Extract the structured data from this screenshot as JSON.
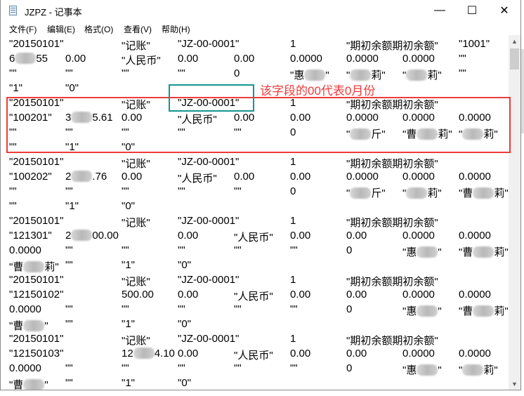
{
  "window": {
    "title": "JZPZ - 记事本",
    "minimize": "—",
    "maximize": "☐",
    "close": "✕"
  },
  "menu": [
    "文件(F)",
    "编辑(E)",
    "格式(O)",
    "查看(V)",
    "帮助(H)"
  ],
  "annotation": {
    "text": "该字段的00代表0月份",
    "color": "#ef3b3b",
    "box_color": "#14968e"
  },
  "lines": [
    [
      [
        0,
        "\"20150101\""
      ],
      [
        2,
        "\"记账\""
      ],
      [
        3,
        "\"JZ-00-0001\""
      ],
      [
        5,
        "1"
      ],
      [
        6,
        "\"期初余额期初余额\""
      ],
      [
        8,
        "\"1001\""
      ]
    ],
    [
      [
        0,
        {
          "pre": "6",
          "post": "55"
        }
      ],
      [
        1,
        "0.00"
      ],
      [
        2,
        "\"人民币\""
      ],
      [
        3,
        "0.00"
      ],
      [
        4,
        "0.00"
      ],
      [
        5,
        "0.0000"
      ],
      [
        6,
        "0.0000"
      ],
      [
        7,
        "0.0000"
      ],
      [
        8,
        "\"\""
      ]
    ],
    [
      [
        0,
        "\"\""
      ],
      [
        1,
        "\"\""
      ],
      [
        2,
        "\"\""
      ],
      [
        3,
        "\"\""
      ],
      [
        4,
        "0"
      ],
      [
        5,
        {
          "pre": "\"惠",
          "post": "\""
        }
      ],
      [
        6,
        {
          "pre": "\"",
          "post": "莉\""
        }
      ],
      [
        7,
        {
          "pre": "\"",
          "post": "莉\""
        }
      ],
      [
        8,
        "\"\""
      ]
    ],
    [
      [
        0,
        "\"1\""
      ],
      [
        1,
        "\"0\""
      ]
    ],
    [
      [
        0,
        "\"20150101\""
      ],
      [
        2,
        "\"记账\""
      ],
      [
        3,
        "\"JZ-00-0001\""
      ],
      [
        5,
        "1"
      ],
      [
        6,
        "\"期初余额期初余额\""
      ]
    ],
    [
      [
        0,
        "\"100201\""
      ],
      [
        1,
        {
          "pre": "3",
          "post": "5.61"
        }
      ],
      [
        2,
        "0.00"
      ],
      [
        3,
        "\"人民币\""
      ],
      [
        4,
        "0.00"
      ],
      [
        5,
        "0.00"
      ],
      [
        6,
        "0.0000"
      ],
      [
        7,
        "0.0000"
      ],
      [
        8,
        "0.0000"
      ]
    ],
    [
      [
        0,
        "\"\""
      ],
      [
        1,
        "\"\""
      ],
      [
        2,
        "\"\""
      ],
      [
        3,
        "\"\""
      ],
      [
        4,
        "\"\""
      ],
      [
        5,
        "0"
      ],
      [
        6,
        {
          "pre": "\"",
          "post": "斤\""
        }
      ],
      [
        7,
        {
          "pre": "\"曹",
          "post": "莉\""
        }
      ],
      [
        8,
        {
          "pre": "\"",
          "post": "莉\""
        }
      ]
    ],
    [
      [
        0,
        "\"\""
      ],
      [
        1,
        "\"1\""
      ],
      [
        2,
        "\"0\""
      ]
    ],
    [
      [
        0,
        "\"20150101\""
      ],
      [
        2,
        "\"记账\""
      ],
      [
        3,
        "\"JZ-00-0001\""
      ],
      [
        5,
        "1"
      ],
      [
        6,
        "\"期初余额期初余额\""
      ]
    ],
    [
      [
        0,
        "\"100202\""
      ],
      [
        1,
        {
          "pre": "2",
          "post": ".76"
        }
      ],
      [
        2,
        "0.00"
      ],
      [
        3,
        "\"人民币\""
      ],
      [
        4,
        "0.00"
      ],
      [
        5,
        "0.00"
      ],
      [
        6,
        "0.0000"
      ],
      [
        7,
        "0.0000"
      ],
      [
        8,
        "0.0000"
      ]
    ],
    [
      [
        0,
        "\"\""
      ],
      [
        1,
        "\"\""
      ],
      [
        2,
        "\"\""
      ],
      [
        3,
        "\"\""
      ],
      [
        4,
        "\"\""
      ],
      [
        5,
        "0"
      ],
      [
        6,
        {
          "pre": "\"",
          "post": "斤\""
        }
      ],
      [
        7,
        {
          "pre": "\"",
          "post": "莉\""
        }
      ],
      [
        8,
        {
          "pre": "\"曹",
          "post": "莉\""
        }
      ]
    ],
    [
      [
        0,
        "\"\""
      ],
      [
        1,
        "\"1\""
      ],
      [
        2,
        "\"0\""
      ]
    ],
    [
      [
        0,
        "\"20150101\""
      ],
      [
        2,
        "\"记账\""
      ],
      [
        3,
        "\"JZ-00-0001\""
      ],
      [
        5,
        "1"
      ],
      [
        6,
        "\"期初余额期初余额\""
      ]
    ],
    [
      [
        0,
        "\"121301\""
      ],
      [
        1,
        {
          "pre": "2",
          "post": "00.00"
        }
      ],
      [
        3,
        "0.00"
      ],
      [
        4,
        "\"人民币\""
      ],
      [
        5,
        "0.00"
      ],
      [
        6,
        "0.00"
      ],
      [
        7,
        "0.0000"
      ],
      [
        8,
        "0.0000"
      ]
    ],
    [
      [
        0,
        "0.0000"
      ],
      [
        1,
        "\"\""
      ],
      [
        2,
        "\"\""
      ],
      [
        3,
        "\"\""
      ],
      [
        4,
        "\"\""
      ],
      [
        5,
        "\"\""
      ],
      [
        6,
        "0"
      ],
      [
        7,
        {
          "pre": "\"惠",
          "post": "\""
        }
      ],
      [
        8,
        {
          "pre": "\"曹",
          "post": "莉\""
        }
      ]
    ],
    [
      [
        0,
        {
          "pre": "\"曹",
          "post": "莉\""
        }
      ],
      [
        1,
        "\"\""
      ],
      [
        2,
        "\"1\""
      ],
      [
        3,
        "\"0\""
      ]
    ],
    [
      [
        0,
        "\"20150101\""
      ],
      [
        2,
        "\"记账\""
      ],
      [
        3,
        "\"JZ-00-0001\""
      ],
      [
        5,
        "1"
      ],
      [
        6,
        "\"期初余额期初余额\""
      ]
    ],
    [
      [
        0,
        "\"12150102\""
      ],
      [
        2,
        "500.00"
      ],
      [
        3,
        "0.00"
      ],
      [
        4,
        "\"人民币\""
      ],
      [
        5,
        "0.00"
      ],
      [
        6,
        "0.00"
      ],
      [
        7,
        "0.0000"
      ],
      [
        8,
        "0.0000"
      ]
    ],
    [
      [
        0,
        "0.0000"
      ],
      [
        1,
        "\"\""
      ],
      [
        2,
        "\"\""
      ],
      [
        3,
        "\"\""
      ],
      [
        4,
        "\"\""
      ],
      [
        5,
        "\"\""
      ],
      [
        6,
        "0"
      ],
      [
        7,
        {
          "pre": "\"惠",
          "post": "\""
        }
      ],
      [
        8,
        {
          "pre": "\"曹",
          "post": "莉\""
        }
      ]
    ],
    [
      [
        0,
        {
          "pre": "\"曹",
          "post": "\""
        }
      ],
      [
        1,
        "\"\""
      ],
      [
        2,
        "\"1\""
      ],
      [
        3,
        "\"0\""
      ]
    ],
    [
      [
        0,
        "\"20150101\""
      ],
      [
        2,
        "\"记账\""
      ],
      [
        3,
        "\"JZ-00-0001\""
      ],
      [
        5,
        "1"
      ],
      [
        6,
        "\"期初余额期初余额\""
      ]
    ],
    [
      [
        0,
        "\"12150103\""
      ],
      [
        2,
        {
          "pre": "12",
          "post": "4.10"
        }
      ],
      [
        3,
        "0.00"
      ],
      [
        4,
        "\"人民币\""
      ],
      [
        5,
        "0.00"
      ],
      [
        6,
        "0.00"
      ],
      [
        7,
        "0.0000"
      ],
      [
        8,
        "0.0000"
      ]
    ],
    [
      [
        0,
        "0.0000"
      ],
      [
        1,
        "\"\""
      ],
      [
        2,
        "\"\""
      ],
      [
        3,
        "\"\""
      ],
      [
        4,
        "\"\""
      ],
      [
        5,
        "\"\""
      ],
      [
        6,
        "0"
      ],
      [
        7,
        {
          "pre": "\"惠",
          "post": "\""
        }
      ],
      [
        8,
        {
          "pre": "\"",
          "post": "莉\""
        }
      ]
    ],
    [
      [
        0,
        {
          "pre": "\"曹",
          "post": "\""
        }
      ],
      [
        1,
        "\"\""
      ],
      [
        2,
        "\"1\""
      ],
      [
        3,
        "\"0\""
      ]
    ]
  ]
}
